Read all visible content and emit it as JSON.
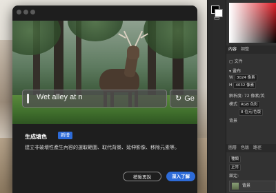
{
  "dialog": {
    "prompt_value": "Wet alley at n",
    "generate_label": "Ge",
    "feature_title": "生成填色",
    "new_badge": "新增",
    "description": "建立非破壞性產生內容的選取範圍、取代背景、延伸影像、移除元素等。",
    "later_button": "稍後再說",
    "learn_button": "深入了解"
  },
  "right_panel": {
    "tabs": [
      "內容",
      "調整"
    ],
    "doc_label": "文件",
    "section_canvas": "畫布",
    "width_label": "W",
    "width_value": "3024 像素",
    "height_label": "H",
    "height_value": "4032 像素",
    "resolution": "解析度: 72 像素/英",
    "mode_label": "模式",
    "mode_value": "RGB 色彩",
    "bit_depth": "8 位元/色版",
    "bg_label": "背景",
    "layers_tabs": [
      "圖層",
      "色版",
      "路徑"
    ],
    "search_placeholder": "種類",
    "blend_mode": "正常",
    "lock_label": "鎖定:",
    "layer_name": "背景"
  },
  "icons": {
    "tool1": "stack-icon",
    "tool2": "chat-bubble-icon"
  },
  "colors": {
    "accent": "#2d6bd8",
    "dialog_bg": "#1e1e1e",
    "panel_bg": "#323232"
  }
}
